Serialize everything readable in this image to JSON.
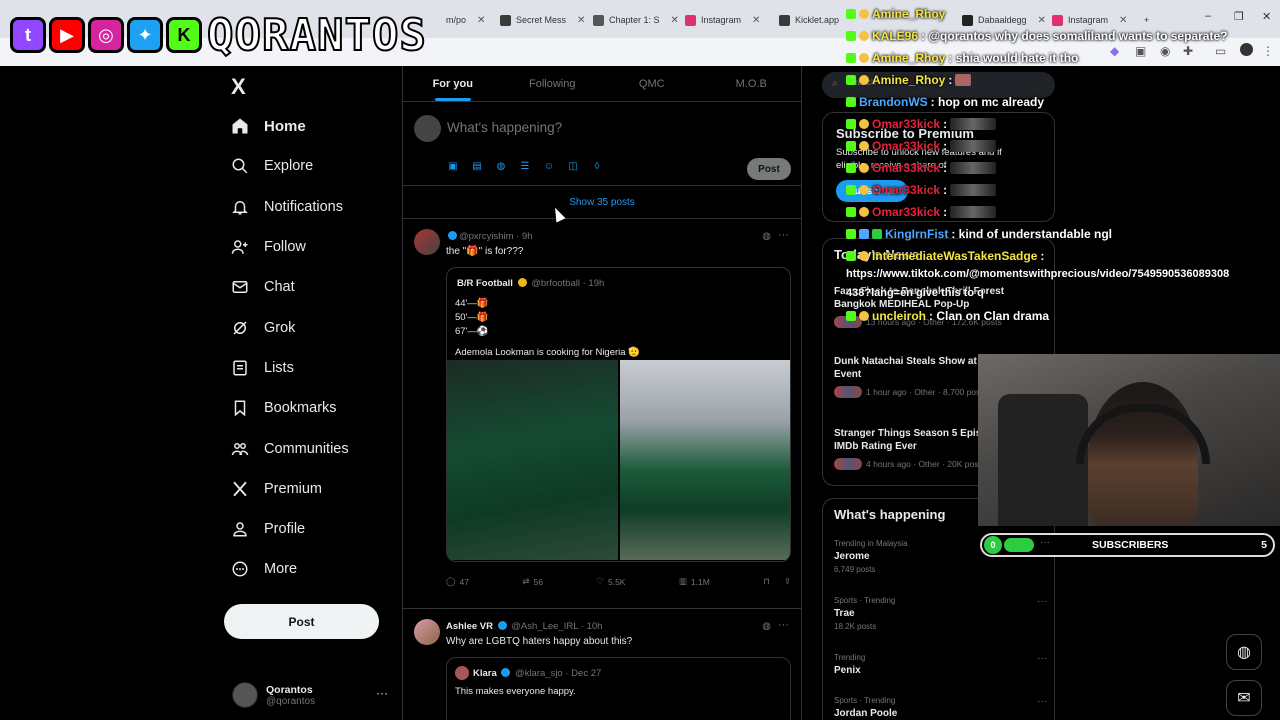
{
  "browser": {
    "tabs": [
      {
        "label": "m/po",
        "color": "#cfcfcf"
      },
      {
        "label": "Secret Mess",
        "color": "#3b3b3b"
      },
      {
        "label": "Chapter 1: S",
        "color": "#555555"
      },
      {
        "label": "Instagram",
        "color": "#e1306c"
      },
      {
        "label": "Kicklet.app",
        "color": "#3a3a3a"
      },
      {
        "label": "The Best Cr",
        "color": "#666666"
      },
      {
        "label": "Dabaaldegg",
        "color": "#222222"
      },
      {
        "label": "Instagram",
        "color": "#e1306c"
      }
    ],
    "new_tab": "+",
    "win_min": "–",
    "win_max": "❐",
    "win_close": "✕"
  },
  "overlay": {
    "brand": "QORANTOS",
    "socials": [
      {
        "icon": "twitch-icon",
        "glyph": "t",
        "color": "#9146ff"
      },
      {
        "icon": "youtube-icon",
        "glyph": "▶",
        "color": "#ff0000"
      },
      {
        "icon": "instagram-icon",
        "glyph": "◎",
        "color": "#d6249f"
      },
      {
        "icon": "twitter-icon",
        "glyph": "✦",
        "color": "#1da1f2"
      },
      {
        "icon": "kick-icon",
        "glyph": "K",
        "color": "#53fc18"
      }
    ]
  },
  "sidebar": {
    "logo": "X",
    "items": [
      {
        "label": "Home",
        "icon": "home-icon",
        "active": true
      },
      {
        "label": "Explore",
        "icon": "search-icon"
      },
      {
        "label": "Notifications",
        "icon": "bell-icon"
      },
      {
        "label": "Follow",
        "icon": "person-add-icon"
      },
      {
        "label": "Chat",
        "icon": "mail-icon"
      },
      {
        "label": "Grok",
        "icon": "grok-icon"
      },
      {
        "label": "Lists",
        "icon": "list-icon"
      },
      {
        "label": "Bookmarks",
        "icon": "bookmark-icon"
      },
      {
        "label": "Communities",
        "icon": "communities-icon"
      },
      {
        "label": "Premium",
        "icon": "x-premium-icon"
      },
      {
        "label": "Profile",
        "icon": "profile-icon"
      },
      {
        "label": "More",
        "icon": "more-icon"
      }
    ],
    "post_label": "Post",
    "account": {
      "name": "Qorantos",
      "handle": "@qorantos",
      "more": "···"
    }
  },
  "timeline": {
    "tabs": [
      "For you",
      "Following",
      "QMC",
      "M.O.B"
    ],
    "compose_placeholder": "What's happening?",
    "compose_post": "Post",
    "show_posts": "Show 35 posts",
    "tweet1": {
      "handle": "@pxrcyishim",
      "time": "9h",
      "text": "the \"🎁\" is for???",
      "quote": {
        "name": "B/R Football",
        "handle": "@brfootball",
        "time": "19h",
        "lines": [
          "44'—🎁",
          "50'—🎁",
          "67'—⚽",
          "Ademola Lookman is cooking for Nigeria 🫡"
        ]
      },
      "stats": {
        "replies": "47",
        "reposts": "56",
        "likes": "5.5K",
        "views": "1.1M"
      }
    },
    "tweet2": {
      "name": "Ashlee VR",
      "handle": "@Ash_Lee_IRL",
      "time": "10h",
      "text": "Why are LGBTQ haters happy about this?",
      "quote": {
        "name": "Klara",
        "handle": "@klara_sjo",
        "time": "Dec 27",
        "text": "This makes everyone happy."
      }
    }
  },
  "right": {
    "search_placeholder": "Search",
    "premium": {
      "title": "Subscribe to Premium",
      "text": "Subscribe to unlock new features and if eligible, receive a share of",
      "button": "Subscribe"
    },
    "news": {
      "title": "Today's News",
      "items": [
        {
          "title": "Fans Flock to Bangkok Thrill Forest Bangkok MEDIHEAL Pop-Up",
          "meta": "13 hours ago · Other · 172.6K posts"
        },
        {
          "title": "Dunk Natachai Steals Show at New Year's Event",
          "meta": "1 hour ago · Other · 8,700 posts"
        },
        {
          "title": "Stranger Things Season 5 Episode Lowest IMDb Rating Ever",
          "meta": "4 hours ago · Other · 20K posts"
        }
      ]
    },
    "happening": {
      "title": "What's happening",
      "trends": [
        {
          "category": "Trending in Malaysia",
          "name": "Jerome",
          "posts": "6,749 posts"
        },
        {
          "category": "Sports · Trending",
          "name": "Trae",
          "posts": "18.2K posts"
        },
        {
          "category": "Trending",
          "name": "Penix",
          "posts": ""
        },
        {
          "category": "Sports · Trending",
          "name": "Jordan Poole",
          "posts": ""
        }
      ]
    }
  },
  "chat": [
    {
      "user": "Amine_Rhoy",
      "color": "#f5e642",
      "msg": ""
    },
    {
      "user": "KALE96",
      "color": "#f5e642",
      "msg": ": @qorantos why does somaliland wants to separate?"
    },
    {
      "user": "Amine_Rhoy",
      "color": "#f5e642",
      "msg": ": shia would hate it tho"
    },
    {
      "user": "Amine_Rhoy",
      "color": "#f5e642",
      "msg": ":"
    },
    {
      "user": "BrandonWS",
      "color": "#4ea8ff",
      "msg": ": hop on mc already"
    },
    {
      "user": "Omar33kick",
      "color": "#e0233a",
      "msg": ":"
    },
    {
      "user": "Omar33kick",
      "color": "#e0233a",
      "msg": ":"
    },
    {
      "user": "Omar33kick",
      "color": "#e0233a",
      "msg": ":"
    },
    {
      "user": "Omar33kick",
      "color": "#e0233a",
      "msg": ":"
    },
    {
      "user": "Omar33kick",
      "color": "#e0233a",
      "msg": ":"
    },
    {
      "user": "KingIrnFist",
      "color": "#4ea8ff",
      "msg": ": kind of understandable ngl"
    },
    {
      "user": "IntermediateWasTakenSadge",
      "color": "#f5e642",
      "msg": ":"
    },
    {
      "user": "",
      "color": "#ffffff",
      "msg": "https://www.tiktok.com/@momentswithprecious/video/7549590536089308"
    },
    {
      "user": "",
      "color": "#ffffff",
      "msg": "438?lang=en give this to q"
    },
    {
      "user": "uncleiroh",
      "color": "#f5e642",
      "msg": ": Clan on Clan drama"
    }
  ],
  "subs": {
    "current": "0",
    "label": "SUBSCRIBERS",
    "goal": "5",
    "dots": "···"
  },
  "colors": {
    "accent": "#1d9bf0",
    "background": "#000000",
    "border": "#2f3336",
    "muted": "#71767b"
  }
}
